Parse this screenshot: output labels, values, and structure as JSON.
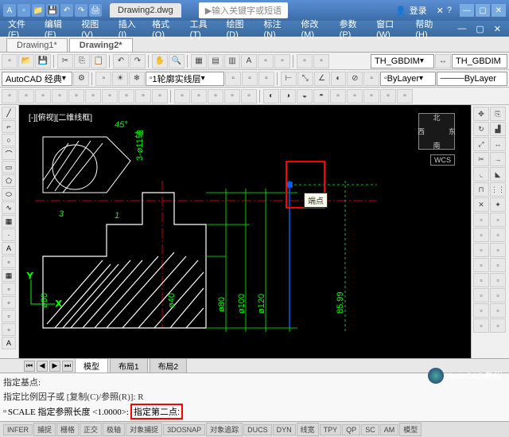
{
  "title": {
    "filename": "Drawing2.dwg",
    "search_placeholder": "输入关键字或短语",
    "login": "登录"
  },
  "compass": {
    "n": "北",
    "s": "南",
    "e": "东",
    "w": "西",
    "wcs": "WCS"
  },
  "menu": {
    "file": "文件(F)",
    "edit": "编辑(E)",
    "view": "视图(V)",
    "insert": "插入(I)",
    "format": "格式(O)",
    "tools": "工具(T)",
    "draw": "绘图(D)",
    "dimension": "标注(N)",
    "modify": "修改(M)",
    "params": "参数(P)",
    "window": "窗口(W)",
    "help": "帮助(H)"
  },
  "doctabs": {
    "tab1": "Drawing1*",
    "tab2": "Drawing2*"
  },
  "toolbar2": {
    "workspace": "AutoCAD 经典",
    "linetype": "1轮廓实线层",
    "dimstyle1": "TH_GBDIM",
    "dimstyle2": "TH_GBDIM"
  },
  "toolbar3": {
    "layer": "ByLayer",
    "layer2": "ByLayer"
  },
  "canvas": {
    "viewlabel": "[-][俯视][二维线框]",
    "tooltip": "端点",
    "dims": {
      "angle": "45°",
      "d1": "3-ø11轴",
      "d2": "3",
      "d3": "1",
      "d4": "ø60",
      "d5": "ø40",
      "d6": "ø80",
      "d7": "ø100",
      "d8": "ø120",
      "d9": "85.99"
    }
  },
  "modeltabs": {
    "model": "模型",
    "layout1": "布局1",
    "layout2": "布局2"
  },
  "cmd": {
    "line1": "指定基点:",
    "line2": "指定比例因子或 [复制(C)/参照(R)]: R",
    "prompt": "SCALE 指定参照长度 <1.0000>:",
    "highlight": "指定第二点:"
  },
  "status": {
    "infer": "INFER",
    "snap": "捕捉",
    "grid": "栅格",
    "ortho": "正交",
    "polar": "极轴",
    "osnap": "对象捕捉",
    "osnap3d": "3DOSNAP",
    "otrack": "对象追踪",
    "ducs": "DUCS",
    "dyn": "DYN",
    "lwt": "线宽",
    "tpy": "TPY",
    "qp": "QP",
    "sc": "SC",
    "am": "AM",
    "model": "模型"
  },
  "watermark": "AutoCAD教程"
}
